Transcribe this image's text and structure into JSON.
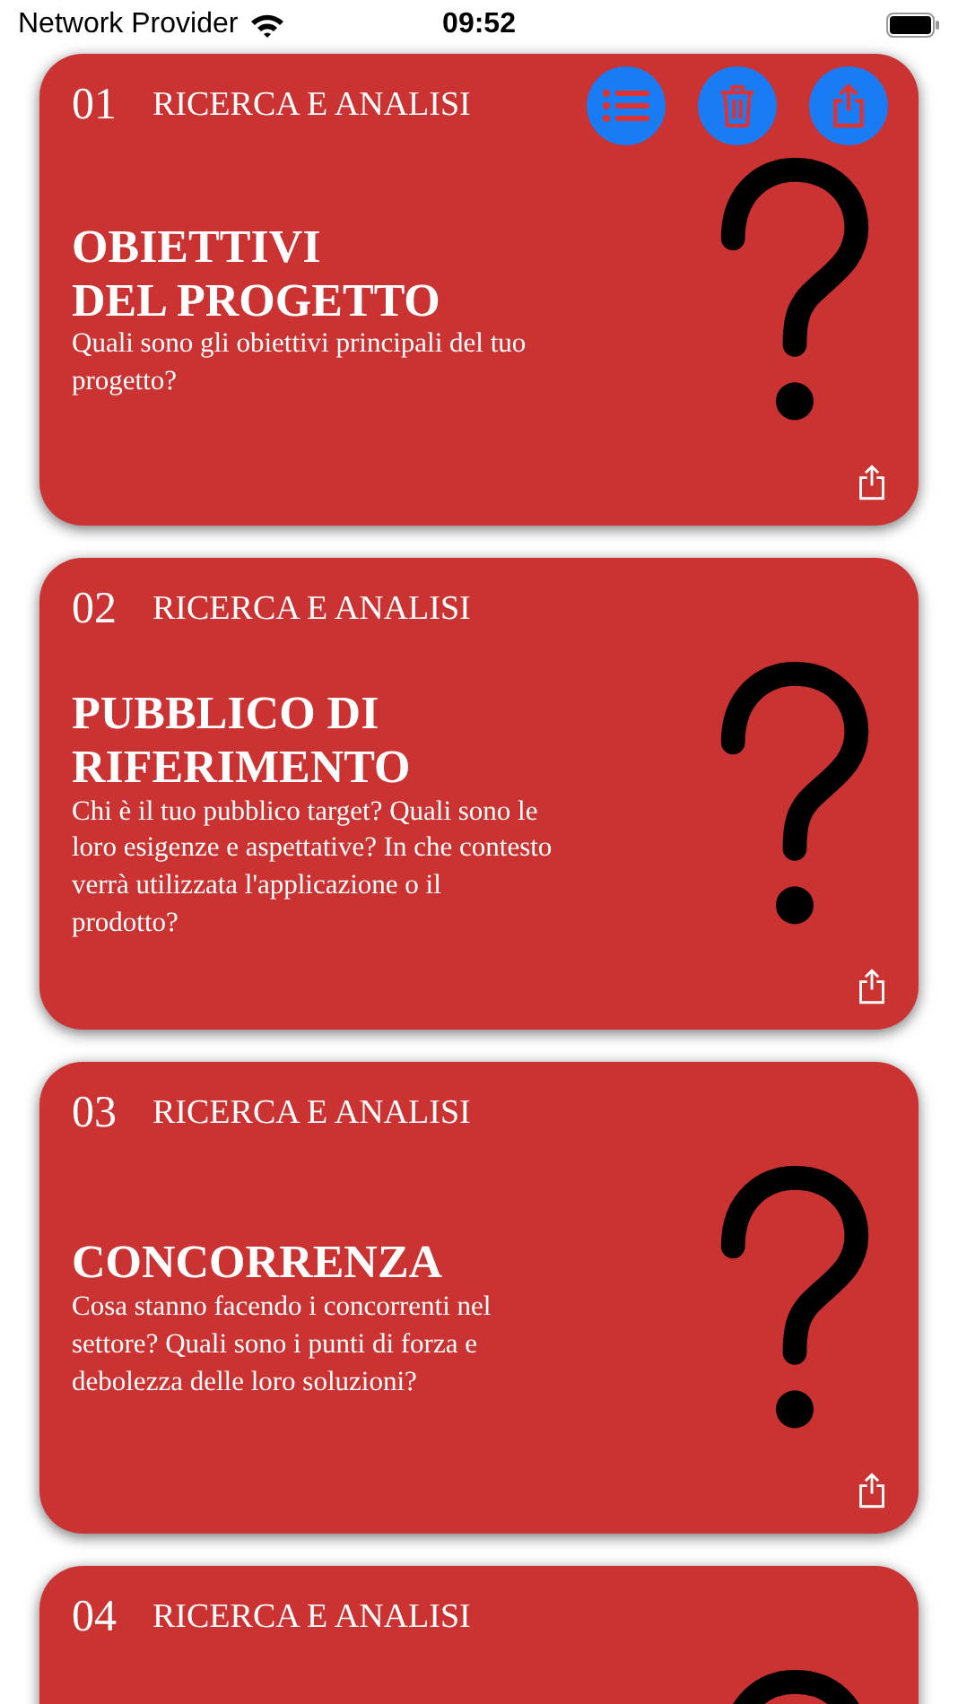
{
  "status_bar": {
    "carrier": "Network Provider",
    "time": "09:52"
  },
  "cards": [
    {
      "number": "01",
      "category": "RICERCA E ANALISI",
      "actions": [
        {
          "kind": "list"
        },
        {
          "kind": "trash"
        },
        {
          "kind": "share"
        }
      ],
      "title": "OBIETTIVI\nDEL PROGETTO",
      "description": "Quali sono gli obiettivi principali del tuo progetto?"
    },
    {
      "number": "02",
      "category": "RICERCA E ANALISI",
      "title": "PUBBLICO DI\nRIFERIMENTO",
      "description": "Chi è il tuo pubblico target? Quali sono le loro esigenze e aspettative? In che contesto verrà utilizzata l'applicazione o il prodotto?"
    },
    {
      "number": "03",
      "category": "RICERCA E ANALISI",
      "title": "CONCORRENZA",
      "description": "Cosa stanno facendo i concorrenti nel settore? Quali sono i punti di forza e debolezza delle loro soluzioni?"
    },
    {
      "number": "04",
      "category": "RICERCA E ANALISI"
    }
  ]
}
